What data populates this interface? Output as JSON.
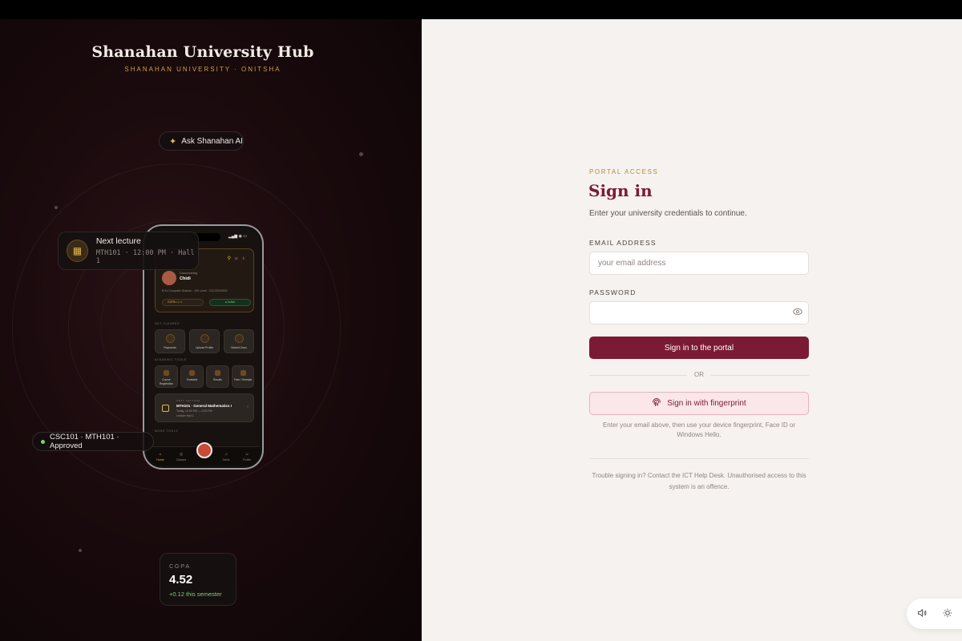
{
  "brand": {
    "title": "Shanahan University Hub",
    "subtitle": "SHANAHAN UNIVERSITY · ONITSHA"
  },
  "ai_chip": {
    "label": "Ask Shanahan AI",
    "icon": "sparkle-icon"
  },
  "lecture_card": {
    "title": "Next lecture",
    "detail": "MTH101 · 12:00 PM · Hall 1",
    "icon": "calendar-icon"
  },
  "approved_chip": {
    "label": "CSC101 · MTH101 · Approved"
  },
  "cgpa_card": {
    "label": "CGPA",
    "value": "4.52",
    "delta": "+0.12 this semester"
  },
  "phone": {
    "status_time": "",
    "greeting": "Good morning",
    "name": "Chidi",
    "info": "B.Sc Computer Science · 100 Level · CSC/2024/003",
    "cgpa_pill": "CGPA • • • •",
    "active_pill": "● Active",
    "sections": {
      "get_cleared": "GET CLEARED",
      "academic_tools": "ACADEMIC TOOLS",
      "more_tools": "MORE TOOLS"
    },
    "clearance_tiles": [
      "Payments",
      "Upload Profile",
      "Submit Docs"
    ],
    "academic_tiles": [
      "Course Registration",
      "Timetable",
      "Results",
      "Fees / Receipts"
    ],
    "next_lecture": {
      "eyebrow": "NEXT LECTURE",
      "title": "MTH101 · General Mathematics I",
      "time": "Today, 12:00 PM — 2:00 PM",
      "venue": "Lecture Hall 1"
    },
    "nav": [
      "Home",
      "Classes",
      "",
      "Alerts",
      "Profile"
    ]
  },
  "signin": {
    "eyebrow": "PORTAL ACCESS",
    "title": "Sign in",
    "subtitle": "Enter your university credentials to continue.",
    "email_label": "EMAIL ADDRESS",
    "email_placeholder": "your email address",
    "email_value": "",
    "password_label": "PASSWORD",
    "password_value": "",
    "submit_label": "Sign in to the portal",
    "or_label": "OR",
    "fingerprint_label": "Sign in with fingerprint",
    "fingerprint_hint": "Enter your email above, then use your device fingerprint, Face ID or Windows Hello.",
    "footer": "Trouble signing in? Contact the ICT Help Desk. Unauthorised access to this system is an offence."
  },
  "controls": {
    "sound_icon": "speaker-icon",
    "theme_icon": "sun-icon"
  },
  "colors": {
    "accent": "#7b1a34",
    "gold": "#c9a14a",
    "success": "#7ed07a"
  }
}
